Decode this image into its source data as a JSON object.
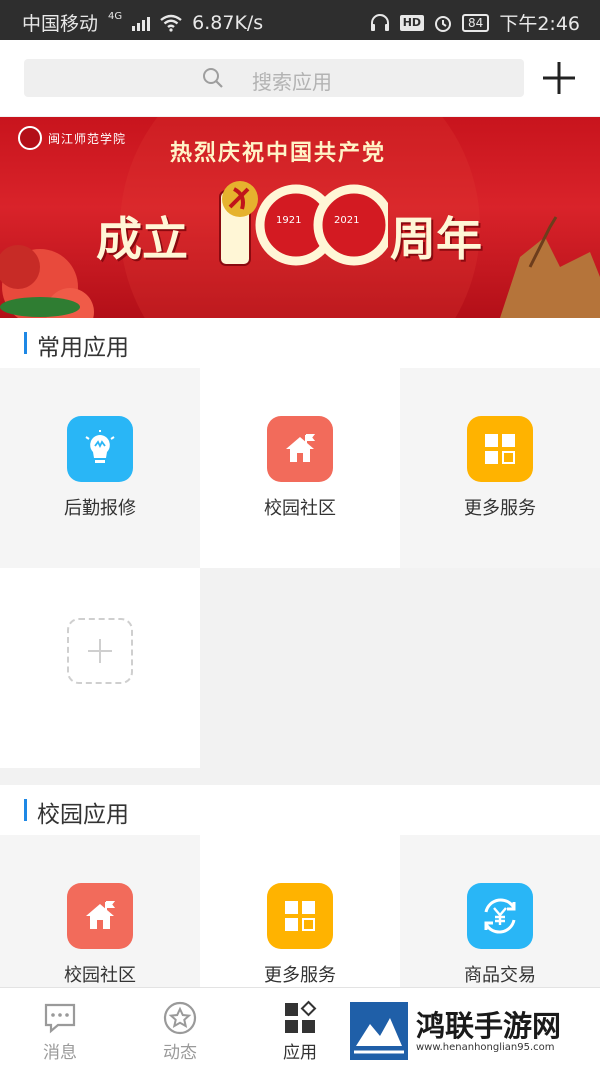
{
  "status_bar": {
    "carrier": "中国移动",
    "network": "4G",
    "speed": "6.87K/s",
    "hd": "HD",
    "battery": "84",
    "time": "下午2:46"
  },
  "search": {
    "placeholder": "搜索应用"
  },
  "banner": {
    "school_name": "闽江师范学院",
    "line1": "热烈庆祝中国共产党",
    "line2_prefix": "成立",
    "line2_number": "100",
    "line2_suffix": "周年",
    "year_start": "1921",
    "year_end": "2021"
  },
  "common_apps": {
    "title": "常用应用",
    "items": [
      {
        "label": "后勤报修",
        "icon": "lightbulb-icon",
        "color": "#29b6f6"
      },
      {
        "label": "校园社区",
        "icon": "house-flag-icon",
        "color": "#f26b5b"
      },
      {
        "label": "更多服务",
        "icon": "grid-icon",
        "color": "#ffb300"
      }
    ]
  },
  "campus_apps": {
    "title": "校园应用",
    "items": [
      {
        "label": "校园社区",
        "icon": "house-flag-icon",
        "color": "#f26b5b"
      },
      {
        "label": "更多服务",
        "icon": "grid-icon",
        "color": "#ffb300"
      },
      {
        "label": "商品交易",
        "icon": "yuan-exchange-icon",
        "color": "#29b6f6"
      }
    ]
  },
  "bottom_nav": {
    "items": [
      {
        "label": "消息",
        "icon": "message-icon"
      },
      {
        "label": "动态",
        "icon": "star-circle-icon"
      },
      {
        "label": "应用",
        "icon": "apps-icon",
        "active": true
      }
    ]
  },
  "watermark": {
    "name": "鸿联手游网",
    "url": "www.henanhonglian95.com"
  }
}
